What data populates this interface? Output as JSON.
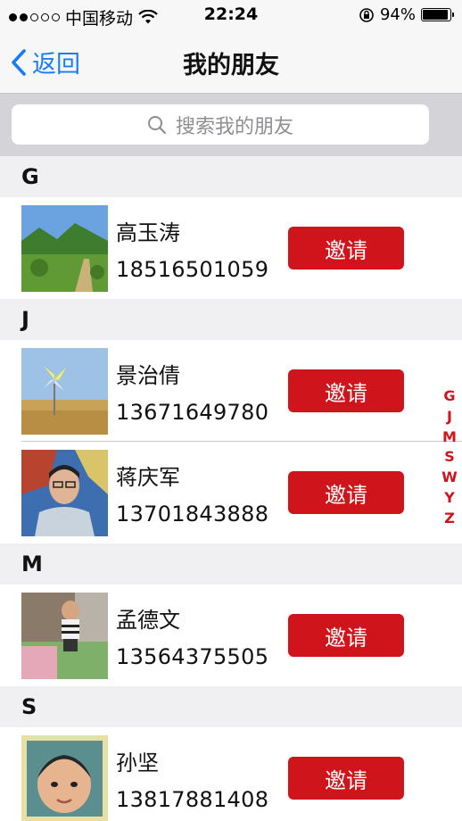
{
  "status_bar": {
    "carrier": "中国移动",
    "time": "22:24",
    "battery": "94%",
    "battery_level": 0.94,
    "signal_bars_full": 2,
    "signal_bars_total": 5
  },
  "nav": {
    "back_label": "返回",
    "title": "我的朋友"
  },
  "search": {
    "placeholder": "搜索我的朋友"
  },
  "sections": [
    {
      "letter": "G"
    },
    {
      "letter": "J"
    },
    {
      "letter": "M"
    },
    {
      "letter": "S"
    }
  ],
  "contacts": [
    {
      "name": "高玉涛",
      "phone": "18516501059",
      "action": "邀请",
      "avatar": "landscape-photo"
    },
    {
      "name": "景治倩",
      "phone": "13671649780",
      "action": "邀请",
      "avatar": "pinwheel-photo"
    },
    {
      "name": "蒋庆军",
      "phone": "13701843888",
      "action": "邀请",
      "avatar": "man-portrait-photo"
    },
    {
      "name": "孟德文",
      "phone": "13564375505",
      "action": "邀请",
      "avatar": "child-playing-photo"
    },
    {
      "name": "孙坚",
      "phone": "13817881408",
      "action": "邀请",
      "avatar": "baby-portrait-photo"
    }
  ],
  "index_letters": [
    "G",
    "J",
    "M",
    "S",
    "W",
    "Y",
    "Z"
  ],
  "colors": {
    "accent_red": "#d0141b",
    "link_blue": "#1a7cf5"
  }
}
